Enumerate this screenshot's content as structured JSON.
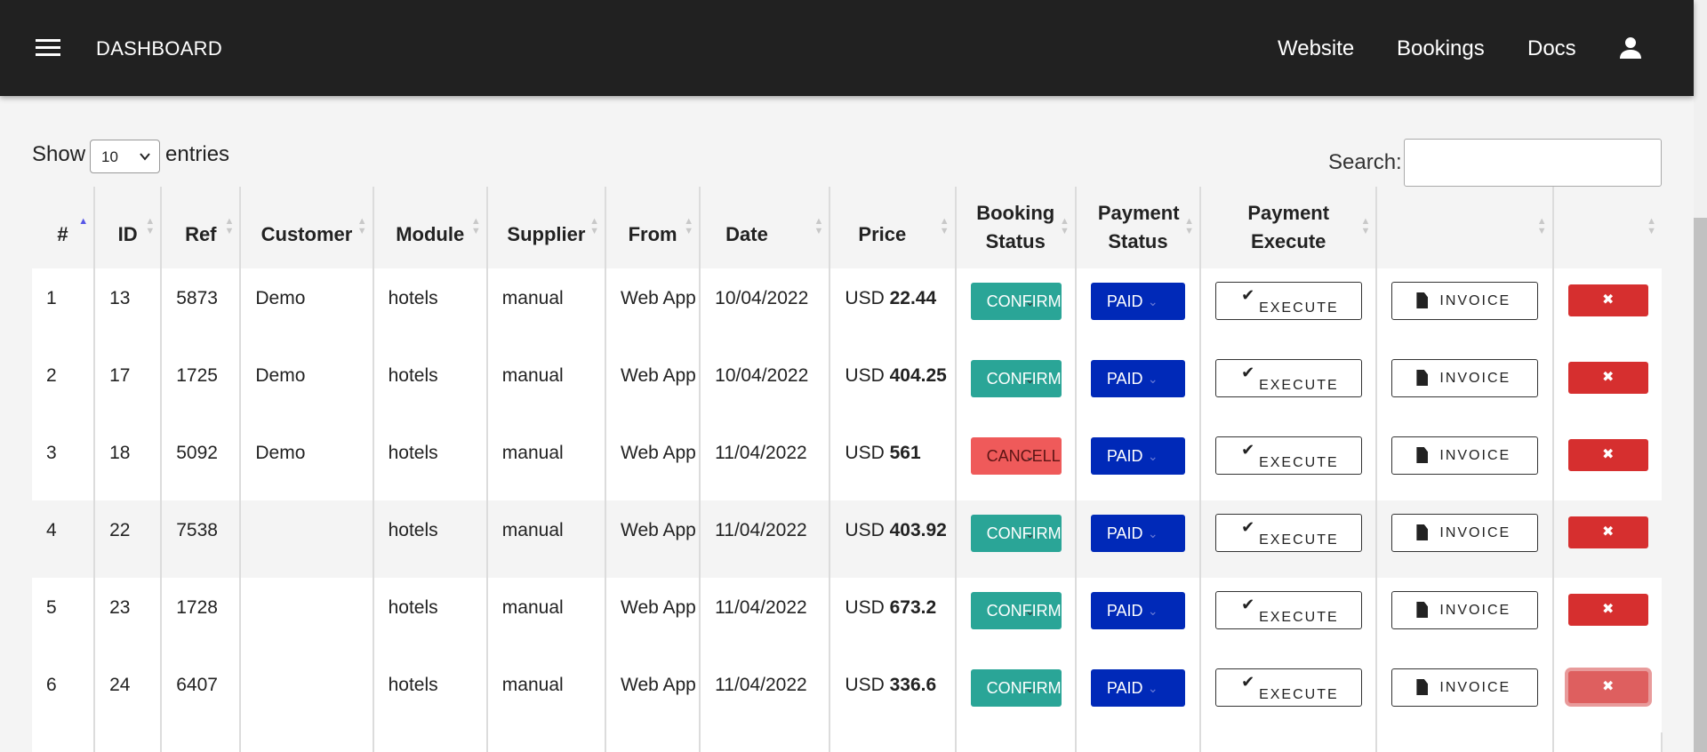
{
  "header": {
    "brand": "DASHBOARD",
    "nav": {
      "website": "Website",
      "bookings": "Bookings",
      "docs": "Docs"
    }
  },
  "controls": {
    "show_label": "Show",
    "entries_value": "10",
    "entries_suffix": "entries",
    "search_label": "Search:",
    "search_value": ""
  },
  "table": {
    "columns": {
      "num": "#",
      "id": "ID",
      "ref": "Ref",
      "customer": "Customer",
      "module": "Module",
      "supplier": "Supplier",
      "from": "From",
      "date": "Date",
      "price": "Price",
      "booking_status": "Booking Status",
      "payment_status": "Payment Status",
      "payment_execute": "Payment Execute",
      "invoice": "",
      "action": ""
    },
    "buttons": {
      "execute": "EXECUTE",
      "invoice": "INVOICE",
      "paid": "PAID",
      "delete": "✖"
    },
    "rows": [
      {
        "num": "1",
        "id": "13",
        "ref": "5873",
        "customer": "Demo",
        "module": "hotels",
        "supplier": "manual",
        "from": "Web App",
        "date": "10/04/2022",
        "currency": "USD",
        "amount": "22.44",
        "booking_status": "CONFIRMED",
        "payment_status": "PAID"
      },
      {
        "num": "2",
        "id": "17",
        "ref": "1725",
        "customer": "Demo",
        "module": "hotels",
        "supplier": "manual",
        "from": "Web App",
        "date": "10/04/2022",
        "currency": "USD",
        "amount": "404.25",
        "booking_status": "CONFIRMED",
        "payment_status": "PAID"
      },
      {
        "num": "3",
        "id": "18",
        "ref": "5092",
        "customer": "Demo",
        "module": "hotels",
        "supplier": "manual",
        "from": "Web App",
        "date": "11/04/2022",
        "currency": "USD",
        "amount": "561",
        "booking_status": "CANCELLED",
        "payment_status": "PAID"
      },
      {
        "num": "4",
        "id": "22",
        "ref": "7538",
        "customer": "",
        "module": "hotels",
        "supplier": "manual",
        "from": "Web App",
        "date": "11/04/2022",
        "currency": "USD",
        "amount": "403.92",
        "booking_status": "CONFIRMED",
        "payment_status": "PAID"
      },
      {
        "num": "5",
        "id": "23",
        "ref": "1728",
        "customer": "",
        "module": "hotels",
        "supplier": "manual",
        "from": "Web App",
        "date": "11/04/2022",
        "currency": "USD",
        "amount": "673.2",
        "booking_status": "CONFIRMED",
        "payment_status": "PAID"
      },
      {
        "num": "6",
        "id": "24",
        "ref": "6407",
        "customer": "",
        "module": "hotels",
        "supplier": "manual",
        "from": "Web App",
        "date": "11/04/2022",
        "currency": "USD",
        "amount": "336.6",
        "booking_status": "CONFIRMED",
        "payment_status": "PAID"
      }
    ]
  },
  "colors": {
    "topbar": "#212121",
    "confirmed": "#2aa597",
    "cancelled": "#ef5a5a",
    "paid": "#0029b8",
    "delete": "#d62f2f",
    "sort_active": "#5656e6"
  },
  "icons": {
    "menu": "hamburger-menu-icon",
    "user": "account-circle-icon",
    "execute": "checkmark-icon",
    "invoice": "document-icon",
    "delete": "cross-icon",
    "sort": "sort-arrows-icon"
  }
}
